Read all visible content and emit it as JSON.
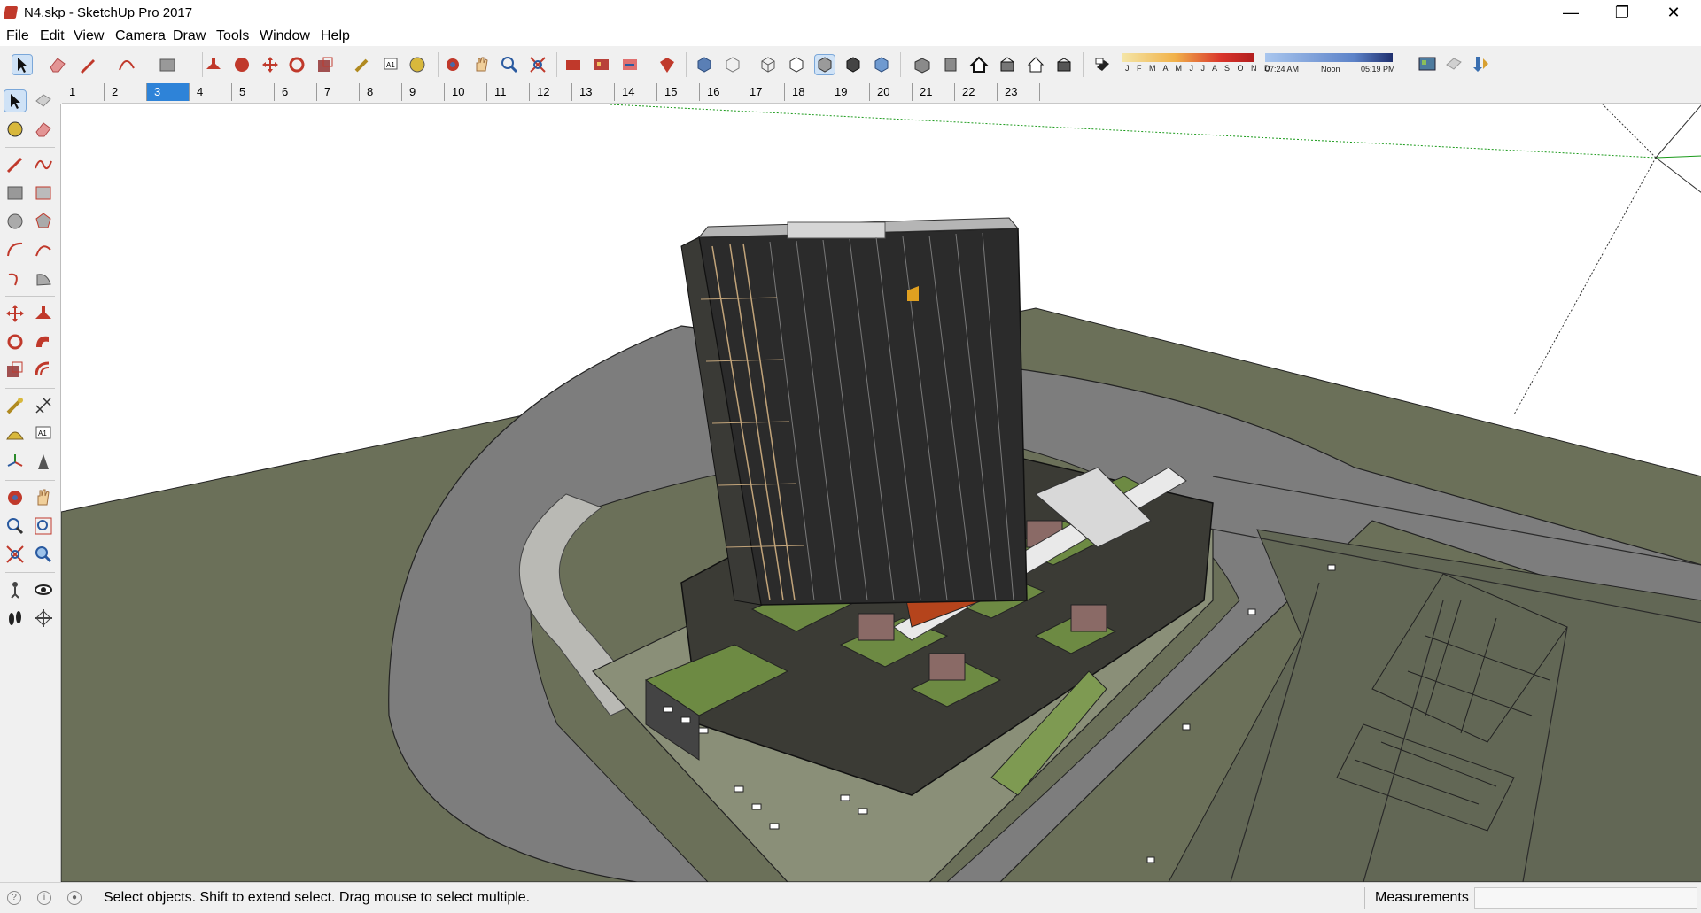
{
  "window": {
    "title": "N4.skp - SketchUp Pro 2017",
    "minimize_glyph": "—",
    "restore_glyph": "❐",
    "close_glyph": "✕"
  },
  "menu": [
    "File",
    "Edit",
    "View",
    "Camera",
    "Draw",
    "Tools",
    "Window",
    "Help"
  ],
  "shadows": {
    "months": "J F M A M J J A S O N D",
    "time_start": "07:24 AM",
    "time_mid": "Noon",
    "time_end": "05:19 PM"
  },
  "scenes": {
    "tabs": [
      "1",
      "2",
      "3",
      "4",
      "5",
      "6",
      "7",
      "8",
      "9",
      "10",
      "11",
      "12",
      "13",
      "14",
      "15",
      "16",
      "17",
      "18",
      "19",
      "20",
      "21",
      "22",
      "23"
    ],
    "active": "3"
  },
  "status": {
    "message": "Select objects. Shift to extend select. Drag mouse to select multiple.",
    "measurements_label": "Measurements",
    "measurements_value": ""
  },
  "colors": {
    "accent": "#2e83d8",
    "ground": "#6b7059",
    "road": "#7a7a7a",
    "tower": "#2b2b2b",
    "roof_green": "#6d8a43",
    "accent_red": "#b5441c"
  }
}
